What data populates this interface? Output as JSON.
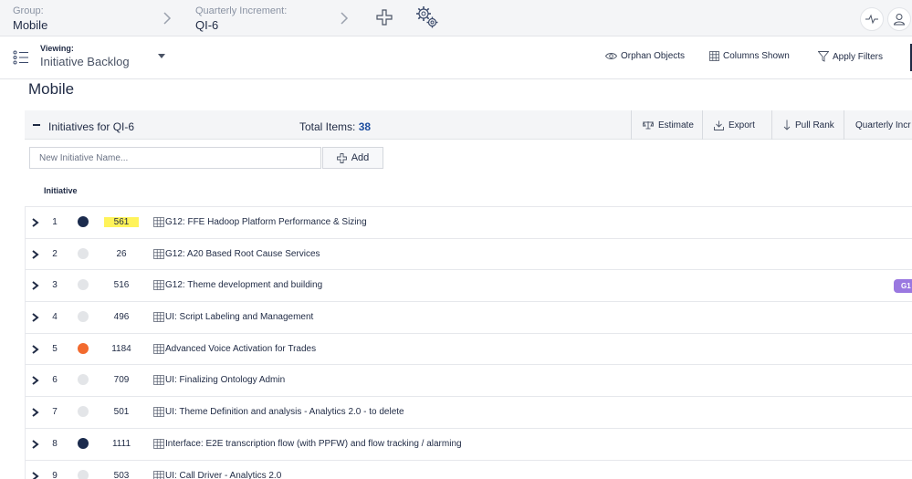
{
  "header": {
    "group_label": "Group:",
    "group_value": "Mobile",
    "qi_label": "Quarterly Increment:",
    "qi_value": "QI-6"
  },
  "viewbar": {
    "viewing_label": "Viewing:",
    "viewing_value": "Initiative Backlog",
    "orphan_objects": "Orphan Objects",
    "columns_shown": "Columns Shown",
    "apply_filters": "Apply Filters"
  },
  "page": {
    "title": "Mobile"
  },
  "section": {
    "title": "Initiatives for  QI-6",
    "total_label": "Total Items:",
    "total_value": "38",
    "actions": {
      "estimate": "Estimate",
      "export": "Export",
      "pull_rank": "Pull Rank",
      "quarterly": "Quarterly Incr"
    }
  },
  "add_form": {
    "placeholder": "New Initiative Name...",
    "add_label": "Add"
  },
  "table": {
    "column_header": "Initiative",
    "rows": [
      {
        "rank": "1",
        "id": "561",
        "name": "G12: FFE Hadoop Platform Performance & Sizing",
        "status_color": "#1b2b4d",
        "highlight": true
      },
      {
        "rank": "2",
        "id": "26",
        "name": "G12: A20 Based Root Cause Services",
        "status_color": "#e3e5e8"
      },
      {
        "rank": "3",
        "id": "516",
        "name": "G12: Theme development and building",
        "status_color": "#e3e5e8",
        "badge": "G1"
      },
      {
        "rank": "4",
        "id": "496",
        "name": "UI: Script Labeling and Management",
        "status_color": "#e3e5e8"
      },
      {
        "rank": "5",
        "id": "1184",
        "name": "Advanced Voice Activation for Trades",
        "status_color": "#f26a2e"
      },
      {
        "rank": "6",
        "id": "709",
        "name": "UI: Finalizing Ontology Admin",
        "status_color": "#e3e5e8"
      },
      {
        "rank": "7",
        "id": "501",
        "name": "UI: Theme Definition and analysis - Analytics 2.0 - to delete",
        "status_color": "#e3e5e8"
      },
      {
        "rank": "8",
        "id": "1111",
        "name": "Interface: E2E transcription flow (with PPFW) and flow tracking / alarming",
        "status_color": "#1b2b4d"
      },
      {
        "rank": "9",
        "id": "503",
        "name": "UI: Call Driver - Analytics 2.0",
        "status_color": "#e3e5e8"
      }
    ]
  },
  "colors": {
    "accent": "#1f4fa0",
    "navy": "#1b2b4d",
    "orange": "#f26a2e",
    "highlight": "#fff35a",
    "badge": "#9a78e0"
  }
}
